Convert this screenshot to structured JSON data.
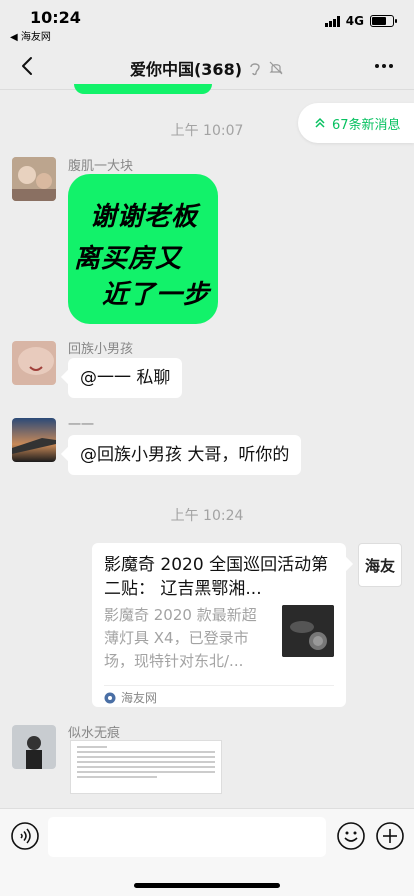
{
  "status_bar": {
    "time": "10:24",
    "back_app": "◀ 海友网",
    "network": "4G",
    "battery_level": 0.7
  },
  "nav": {
    "title": "爱你中国(368)"
  },
  "new_messages": {
    "label": "67条新消息"
  },
  "dividers": {
    "t1": "上午 10:07",
    "t2": "上午 10:24"
  },
  "messages": [
    {
      "sender": "腹肌一大块",
      "sticker_lines": [
        "谢谢老板",
        "离买房又",
        "近了一步"
      ]
    },
    {
      "sender": "回族小男孩",
      "text": "@一一 私聊"
    },
    {
      "sender": "一一",
      "text": "@回族小男孩 大哥，听你的"
    },
    {
      "card": {
        "title": "影魔奇 2020 全国巡回活动第二贴： 辽吉黑鄂湘...",
        "description": "影魔奇 2020 款最新超薄灯具 X4，已登录市场，现特针对东北/...",
        "source": "海友网",
        "logo_text": "海友"
      }
    },
    {
      "sender": "似水无痕"
    }
  ],
  "colors": {
    "accent": "#07c160",
    "sticker_green": "#12f26a",
    "background": "#ededed"
  }
}
